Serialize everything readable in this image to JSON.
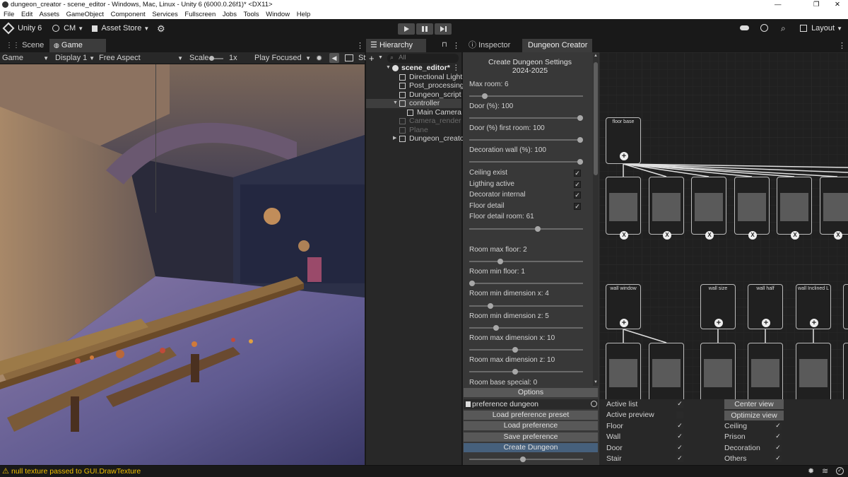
{
  "window": {
    "title": "dungeon_creator - scene_editor - Windows, Mac, Linux - Unity 6 (6000.0.26f1)* <DX11>",
    "controls": [
      "—",
      "❐",
      "✕"
    ]
  },
  "menu": [
    "File",
    "Edit",
    "Assets",
    "GameObject",
    "Component",
    "Services",
    "Fullscreen",
    "Jobs",
    "Tools",
    "Window",
    "Help"
  ],
  "toolbar": {
    "unity_label": "Unity 6",
    "account_label": "CM",
    "asset_store_label": "Asset Store",
    "layout_label": "Layout"
  },
  "tabs": {
    "scene": "Scene",
    "game": "Game",
    "hierarchy": "Hierarchy",
    "inspector": "Inspector",
    "dungeon_creator": "Dungeon Creator"
  },
  "gamebar": {
    "game": "Game",
    "display": "Display 1",
    "aspect": "Free Aspect",
    "scale_label": "Scale",
    "scale_value": "1x",
    "play_focused": "Play Focused",
    "stats": "St"
  },
  "hierarchy": {
    "search_placeholder": "All",
    "scene_name": "scene_editor*",
    "items": [
      {
        "label": "Directional Light",
        "indent": 1,
        "dim": false
      },
      {
        "label": "Post_processing",
        "indent": 1,
        "dim": false
      },
      {
        "label": "Dungeon_script",
        "indent": 1,
        "dim": false
      },
      {
        "label": "controller",
        "indent": 1,
        "dim": false
      },
      {
        "label": "Main Camera",
        "indent": 2,
        "dim": false
      },
      {
        "label": "Camera_render",
        "indent": 1,
        "dim": true
      },
      {
        "label": "Plane",
        "indent": 1,
        "dim": true
      },
      {
        "label": "Dungeon_creato",
        "indent": 1,
        "dim": false
      }
    ]
  },
  "settings": {
    "title_line1": "Create Dungeon Settings",
    "title_line2": "2024-2025",
    "max_room": {
      "label": "Max room: 6",
      "value": 0.12
    },
    "door": {
      "label": "Door (%): 100",
      "value": 1.0
    },
    "door_first": {
      "label": "Door (%) first room: 100",
      "value": 1.0
    },
    "decoration_wall": {
      "label": "Decoration wall  (%): 100",
      "value": 1.0
    },
    "ceiling_exist": {
      "label": "Ceiling exist",
      "checked": true
    },
    "lighting_active": {
      "label": "Ligthing active",
      "checked": true
    },
    "decorator_internal": {
      "label": "Decorator internal",
      "checked": true
    },
    "floor_detail": {
      "label": "Floor detail",
      "checked": true
    },
    "floor_detail_room": {
      "label": "Floor detail room: 61",
      "value": 0.61
    },
    "room_max_floor": {
      "label": "Room max floor: 2",
      "value": 0.26
    },
    "room_min_floor": {
      "label": "Room min floor: 1",
      "value": 0.0
    },
    "room_min_dim_x": {
      "label": "Room min dimension x: 4",
      "value": 0.17
    },
    "room_min_dim_z": {
      "label": "Room min dimension z: 5",
      "value": 0.22
    },
    "room_max_dim_x": {
      "label": "Room max dimension x: 10",
      "value": 0.4
    },
    "room_max_dim_z": {
      "label": "Room max dimension z: 10",
      "value": 0.4
    },
    "room_base_special": {
      "label": "Room base special: 0"
    },
    "options_btn": "Options",
    "preference_field": "preference dungeon",
    "load_preset_btn": "Load preference preset",
    "load_pref_btn": "Load preference",
    "save_pref_btn": "Save preference",
    "create_btn": "Create Dungeon",
    "bottom_slider": 0.47
  },
  "graph": {
    "floor_base": "floor base",
    "wall_window": "wall window",
    "wall_size": "wall size",
    "wall_half": "wall half",
    "wall_inclined": "wall Inclined L"
  },
  "bottom_options": {
    "active_list": {
      "label": "Active list",
      "checked": true
    },
    "active_preview": {
      "label": "Active preview",
      "checked": false
    },
    "floor": {
      "label": "Floor",
      "checked": true
    },
    "wall": {
      "label": "Wall",
      "checked": true
    },
    "door": {
      "label": "Door",
      "checked": true
    },
    "stair": {
      "label": "Stair",
      "checked": true
    },
    "center_view": "Center view",
    "optimize_view": "Optimize view",
    "ceiling": {
      "label": "Ceiling",
      "checked": true
    },
    "prison": {
      "label": "Prison",
      "checked": true
    },
    "decoration": {
      "label": "Decoration",
      "checked": true
    },
    "others": {
      "label": "Others",
      "checked": true
    }
  },
  "status": {
    "message": "null texture passed to GUI.DrawTexture",
    "warning_color": "#f0c000"
  },
  "colors": {
    "create_button": "#46607c",
    "selected_row": "#3e3e3e"
  }
}
